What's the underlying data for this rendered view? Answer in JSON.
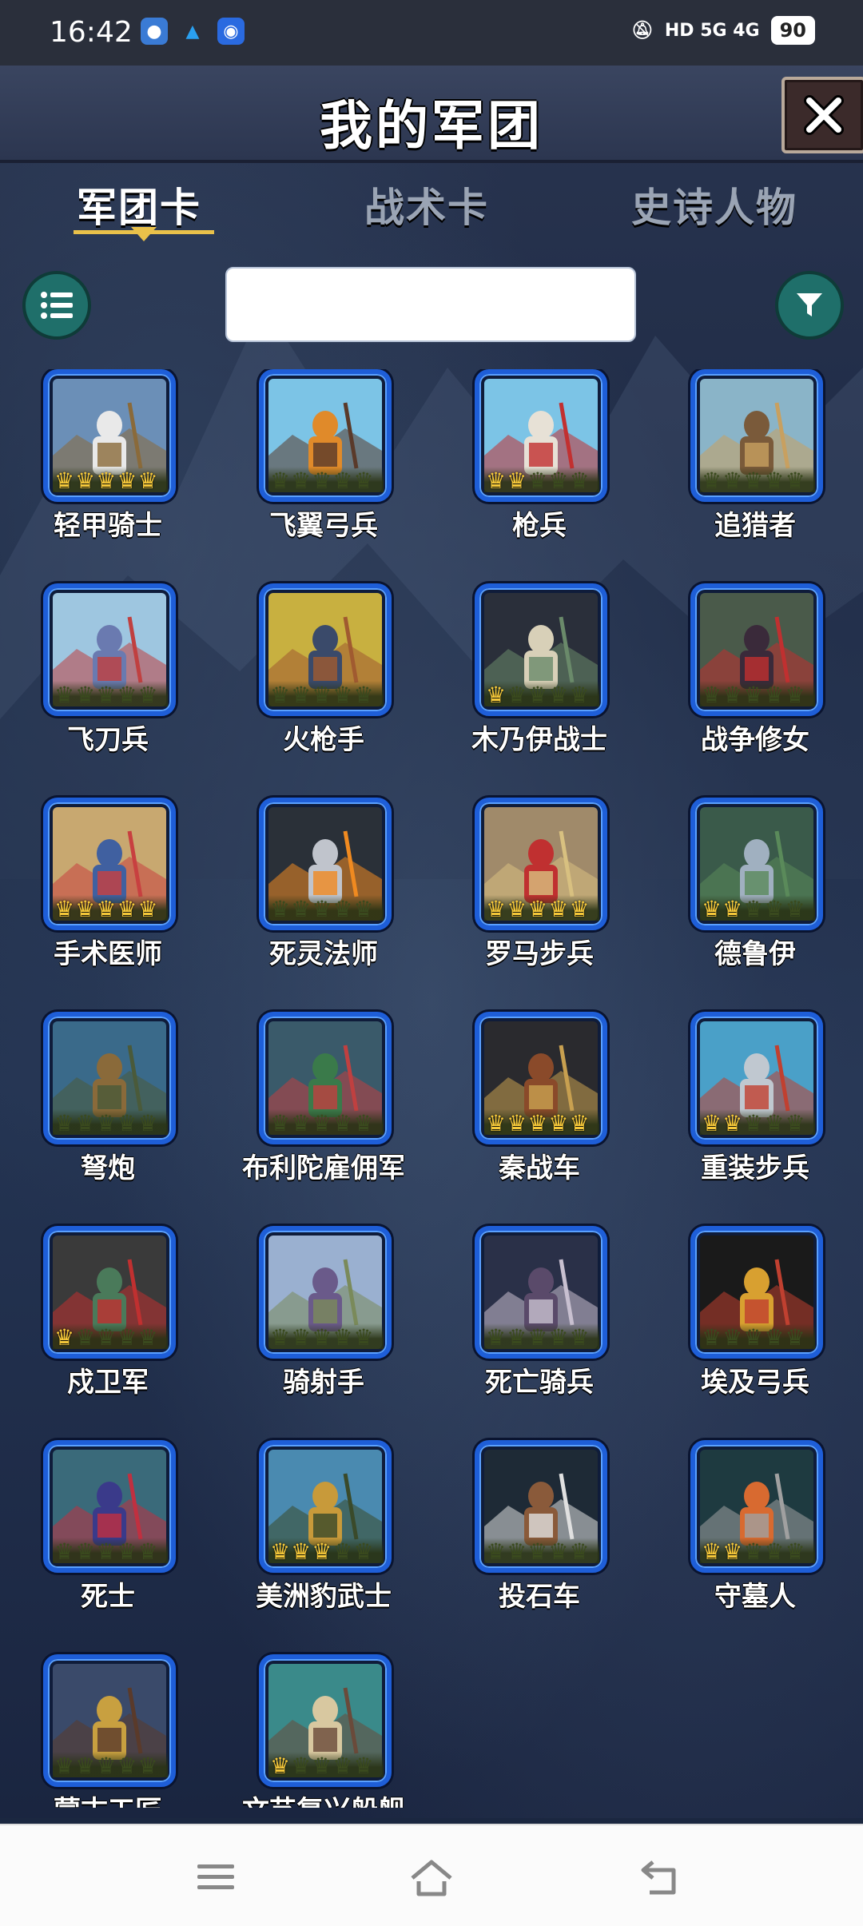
{
  "status_bar": {
    "time": "16:42",
    "right_text": "HD 5G 4G",
    "battery": "90"
  },
  "header": {
    "title": "我的军团",
    "close_label": "✖"
  },
  "tabs": [
    {
      "label": "军团卡",
      "active": true
    },
    {
      "label": "战术卡",
      "active": false
    },
    {
      "label": "史诗人物",
      "active": false
    }
  ],
  "toolbar": {
    "search_value": "",
    "list_icon": "list-icon",
    "filter_icon": "filter-icon"
  },
  "cards": [
    {
      "name": "轻甲骑士",
      "stars": 5,
      "palette": [
        "#6b8fb7",
        "#e9e9e9",
        "#8a6a3a"
      ]
    },
    {
      "name": "飞翼弓兵",
      "stars": 0,
      "palette": [
        "#7cc4e6",
        "#e08a2a",
        "#5a3a2a"
      ]
    },
    {
      "name": "枪兵",
      "stars": 2,
      "palette": [
        "#7cc4e6",
        "#e7e1d6",
        "#c23030"
      ]
    },
    {
      "name": "追猎者",
      "stars": 0,
      "palette": [
        "#8ab4c8",
        "#7a5a3a",
        "#c8a060"
      ]
    },
    {
      "name": "飞刀兵",
      "stars": 0,
      "palette": [
        "#9ec6e0",
        "#6a7ab0",
        "#c04040"
      ]
    },
    {
      "name": "火枪手",
      "stars": 0,
      "palette": [
        "#c8b040",
        "#3a4a6a",
        "#a05a30"
      ]
    },
    {
      "name": "木乃伊战士",
      "stars": 1,
      "palette": [
        "#2a2f3a",
        "#d8d0b8",
        "#6a8a6a"
      ]
    },
    {
      "name": "战争修女",
      "stars": 0,
      "palette": [
        "#4a5a4a",
        "#3a2a3a",
        "#c03030"
      ]
    },
    {
      "name": "手术医师",
      "stars": 5,
      "palette": [
        "#c8a870",
        "#4060a0",
        "#c84040"
      ]
    },
    {
      "name": "死灵法师",
      "stars": 0,
      "palette": [
        "#2a3038",
        "#c0c4cc",
        "#f08a20"
      ]
    },
    {
      "name": "罗马步兵",
      "stars": 5,
      "palette": [
        "#a08a6a",
        "#c03030",
        "#d8c080"
      ]
    },
    {
      "name": "德鲁伊",
      "stars": 2,
      "palette": [
        "#3a5a4a",
        "#a0b0c0",
        "#5a8a5a"
      ]
    },
    {
      "name": "弩炮",
      "stars": 0,
      "palette": [
        "#3a6a8a",
        "#8a6a3a",
        "#4a5a3a"
      ]
    },
    {
      "name": "布利陀雇佣军",
      "stars": 0,
      "palette": [
        "#3a5a6a",
        "#3a7a4a",
        "#c04040"
      ]
    },
    {
      "name": "秦战车",
      "stars": 5,
      "palette": [
        "#2a2a2e",
        "#8a4a2a",
        "#c8a050"
      ]
    },
    {
      "name": "重装步兵",
      "stars": 2,
      "palette": [
        "#4aa0c8",
        "#c0c8d0",
        "#c04030"
      ]
    },
    {
      "name": "戍卫军",
      "stars": 1,
      "palette": [
        "#3a3a3a",
        "#4a7a5a",
        "#c03030"
      ]
    },
    {
      "name": "骑射手",
      "stars": 0,
      "palette": [
        "#9ab0d0",
        "#6a5a8a",
        "#7a8a5a"
      ]
    },
    {
      "name": "死亡骑兵",
      "stars": 0,
      "palette": [
        "#2a3048",
        "#5a4a6a",
        "#c8c0d0"
      ]
    },
    {
      "name": "埃及弓兵",
      "stars": 0,
      "palette": [
        "#1a1a1a",
        "#d8a030",
        "#c04030"
      ]
    },
    {
      "name": "死士",
      "stars": 0,
      "palette": [
        "#3a6a7a",
        "#3a3a8a",
        "#c03040"
      ]
    },
    {
      "name": "美洲豹武士",
      "stars": 3,
      "palette": [
        "#4a8ab0",
        "#c89a3a",
        "#3a4a2a"
      ]
    },
    {
      "name": "投石车",
      "stars": 0,
      "palette": [
        "#1e2a36",
        "#8a5a3a",
        "#e0e0e0"
      ]
    },
    {
      "name": "守墓人",
      "stars": 2,
      "palette": [
        "#1e3a40",
        "#d86a30",
        "#a0a0a0"
      ]
    },
    {
      "name": "蒙古工匠",
      "stars": 0,
      "palette": [
        "#3a4a6a",
        "#c8a040",
        "#5a3a2a"
      ]
    },
    {
      "name": "文艺复兴船舰",
      "stars": 1,
      "palette": [
        "#3a8a8a",
        "#d8c8a0",
        "#6a4a3a"
      ]
    }
  ]
}
